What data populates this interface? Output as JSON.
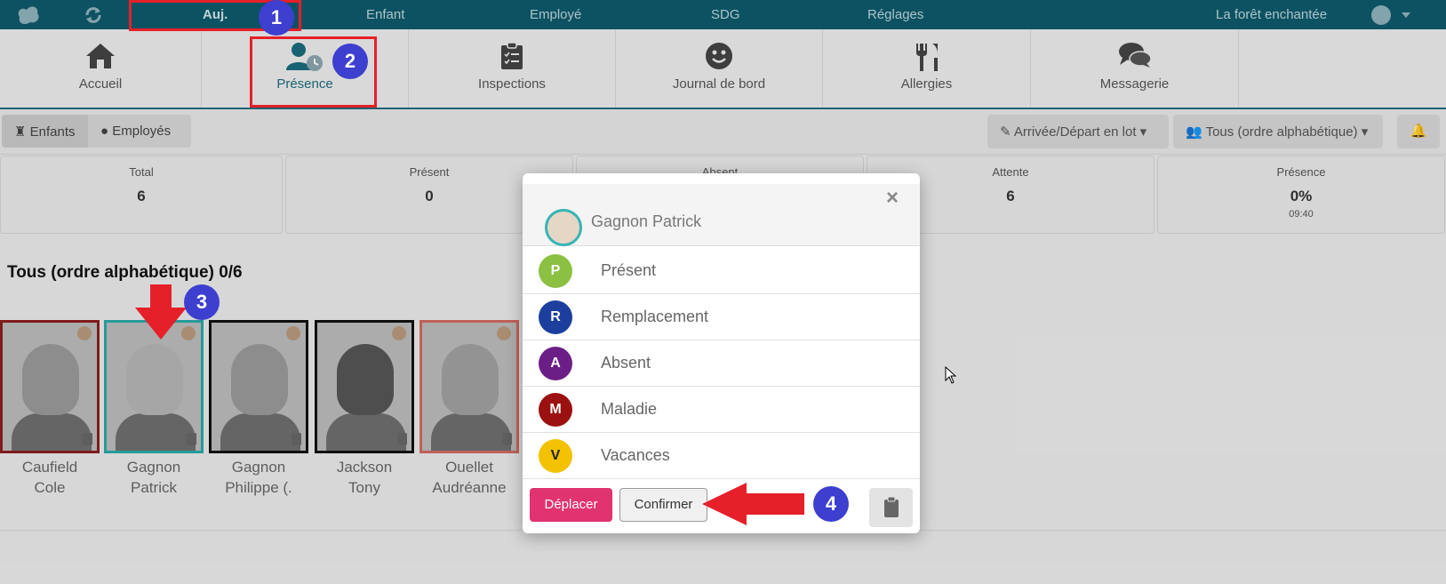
{
  "topnav": {
    "items": [
      "Auj.",
      "Enfant",
      "Employé",
      "SDG",
      "Réglages"
    ],
    "center_name": "La forêt enchantée"
  },
  "subnav": {
    "tiles": [
      "Accueil",
      "Présence",
      "Inspections",
      "Journal de bord",
      "Allergies",
      "Messagerie"
    ],
    "active_index": 1
  },
  "toolbar": {
    "seg_children": "Enfants",
    "seg_employees": "Employés",
    "batch_label": "Arrivée/Départ en lot",
    "sort_label": "Tous (ordre alphabétique)"
  },
  "stats": [
    {
      "label": "Total",
      "value": "6"
    },
    {
      "label": "Présent",
      "value": "0"
    },
    {
      "label": "Absent",
      "value": ""
    },
    {
      "label": "Attente",
      "value": "6"
    },
    {
      "label": "Présence",
      "value": "0%",
      "time": "09:40"
    }
  ],
  "list": {
    "title": "Tous (ordre alphabétique) 0/6",
    "children": [
      {
        "first": "Caufield",
        "second": "Cole",
        "border": "#8b1e1e"
      },
      {
        "first": "Gagnon",
        "second": "Patrick",
        "border": "#2aa8a8"
      },
      {
        "first": "Gagnon",
        "second": "Philippe (.",
        "border": "#111111"
      },
      {
        "first": "Jackson",
        "second": "Tony",
        "border": "#111111"
      },
      {
        "first": "Ouellet",
        "second": "Audréanne",
        "border": "#d06a60"
      }
    ]
  },
  "modal": {
    "child_name": "Gagnon Patrick",
    "close": "×",
    "options": [
      {
        "letter": "P",
        "label": "Présent",
        "color": "#8cc043"
      },
      {
        "letter": "R",
        "label": "Remplacement",
        "color": "#1c3f9e"
      },
      {
        "letter": "A",
        "label": "Absent",
        "color": "#6b1f86"
      },
      {
        "letter": "M",
        "label": "Maladie",
        "color": "#9b1111"
      },
      {
        "letter": "V",
        "label": "Vacances",
        "color": "#f2c200"
      }
    ],
    "move_label": "Déplacer",
    "confirm_label": "Confirmer"
  },
  "annotations": [
    "1",
    "2",
    "3",
    "4"
  ],
  "colors": {
    "nav": "#0f5a6b",
    "accent": "#e52028",
    "step": "#3d3fcf"
  }
}
